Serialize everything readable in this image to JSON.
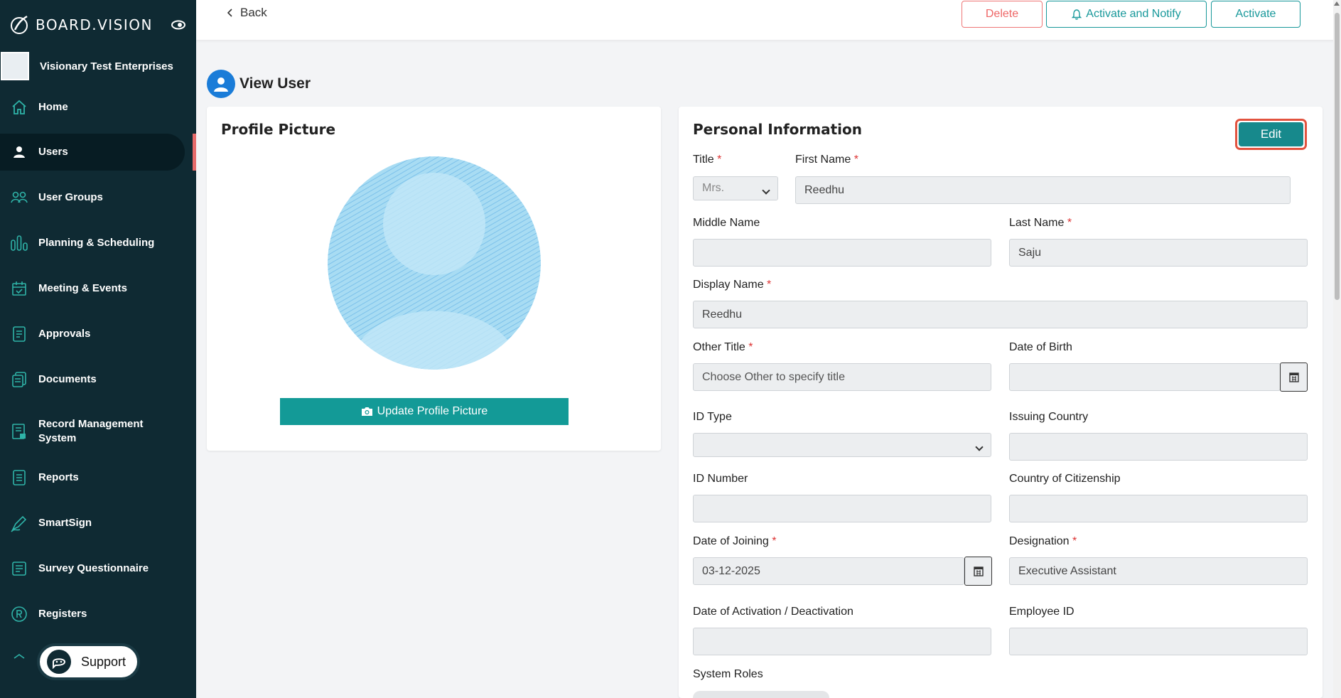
{
  "brand": {
    "name": "BOARD.VISION"
  },
  "org": {
    "name": "Visionary Test Enterprises"
  },
  "sidebar": {
    "items": [
      {
        "label": "Home",
        "icon": "home-icon"
      },
      {
        "label": "Users",
        "icon": "user-icon"
      },
      {
        "label": "User Groups",
        "icon": "user-groups-icon"
      },
      {
        "label": "Planning & Scheduling",
        "icon": "chart-bars-icon"
      },
      {
        "label": "Meeting & Events",
        "icon": "calendar-check-icon"
      },
      {
        "label": "Approvals",
        "icon": "approvals-icon"
      },
      {
        "label": "Documents",
        "icon": "documents-icon"
      },
      {
        "label": "Record Management System",
        "icon": "record-management-icon"
      },
      {
        "label": "Reports",
        "icon": "reports-icon"
      },
      {
        "label": "SmartSign",
        "icon": "pen-icon"
      },
      {
        "label": "Survey Questionnaire",
        "icon": "survey-icon"
      },
      {
        "label": "Registers",
        "icon": "registered-icon"
      }
    ],
    "active": "Users",
    "support_label": "Support"
  },
  "topbar": {
    "back_label": "Back",
    "delete_label": "Delete",
    "notify_label": "Activate and Notify",
    "activate_label": "Activate"
  },
  "page": {
    "title": "View User"
  },
  "profile": {
    "title": "Profile Picture",
    "update_label": "Update Profile Picture"
  },
  "personal": {
    "title": "Personal Information",
    "edit_label": "Edit",
    "fields": {
      "title": {
        "label": "Title",
        "value": "Mrs."
      },
      "first_name": {
        "label": "First Name",
        "value": "Reedhu"
      },
      "middle_name": {
        "label": "Middle Name",
        "value": ""
      },
      "last_name": {
        "label": "Last Name",
        "value": "Saju"
      },
      "display_name": {
        "label": "Display Name",
        "value": "Reedhu"
      },
      "other_title": {
        "label": "Other Title",
        "placeholder": "Choose Other to specify title"
      },
      "dob": {
        "label": "Date of Birth",
        "value": ""
      },
      "id_type": {
        "label": "ID Type",
        "value": ""
      },
      "issuing_country": {
        "label": "Issuing Country",
        "value": ""
      },
      "id_number": {
        "label": "ID Number",
        "value": ""
      },
      "citizenship": {
        "label": "Country of Citizenship",
        "value": ""
      },
      "joining": {
        "label": "Date of Joining",
        "value": "03-12-2025"
      },
      "designation": {
        "label": "Designation",
        "value": "Executive Assistant"
      },
      "activation": {
        "label": "Date of Activation / Deactivation",
        "value": ""
      },
      "employee_id": {
        "label": "Employee ID",
        "value": ""
      },
      "system_roles": {
        "label": "System Roles"
      }
    }
  },
  "colors": {
    "sidebar_bg": "#0f2a33",
    "accent_teal": "#17989a",
    "danger": "#e66666",
    "active_marker": "#e66b6b"
  }
}
